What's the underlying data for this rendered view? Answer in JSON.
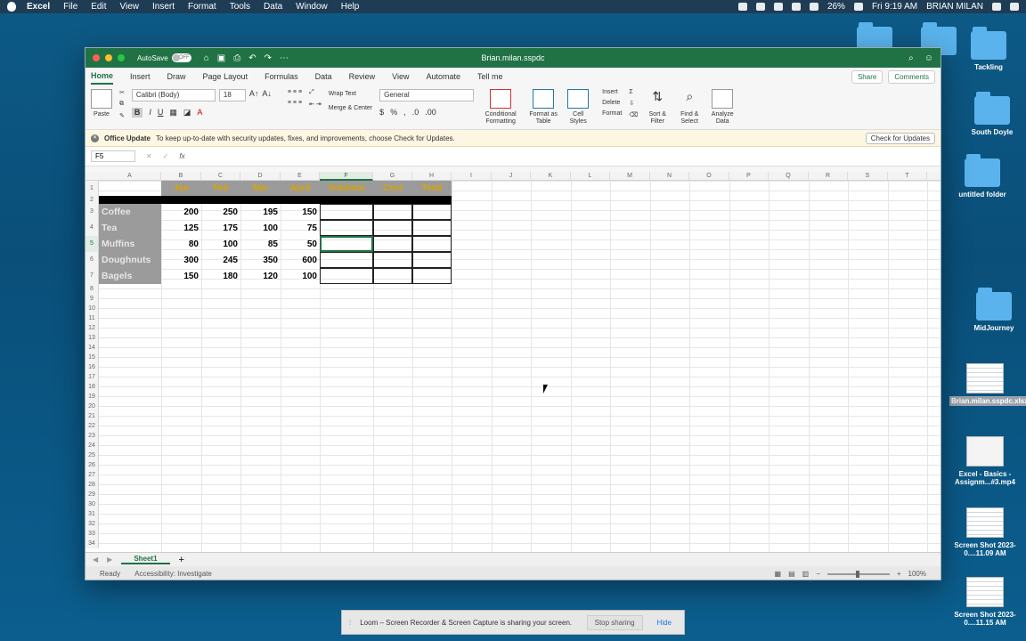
{
  "menubar": {
    "app": "Excel",
    "items": [
      "File",
      "Edit",
      "View",
      "Insert",
      "Format",
      "Tools",
      "Data",
      "Window",
      "Help"
    ],
    "battery": "26%",
    "clock": "Fri 9:19 AM",
    "user": "BRIAN MILAN"
  },
  "desktop": {
    "icons": [
      {
        "label": "Tackling",
        "type": "folder"
      },
      {
        "label": "South Doyle",
        "type": "folder"
      },
      {
        "label": "untitled folder",
        "type": "folder"
      },
      {
        "label": "MidJourney",
        "type": "folder"
      },
      {
        "label": "Brian.milan.sspdc.xlsx",
        "type": "file"
      },
      {
        "label": "Excel - Basics - Assignm...#3.mp4",
        "type": "file"
      },
      {
        "label": "Screen Shot 2023-0....11.09 AM",
        "type": "file"
      },
      {
        "label": "Screen Shot 2023-0....11.15 AM",
        "type": "file"
      }
    ]
  },
  "window": {
    "autosave_label": "AutoSave",
    "autosave_state": "OFF",
    "doc_title": "Brian.milan.sspdc",
    "tabs": [
      "Home",
      "Insert",
      "Draw",
      "Page Layout",
      "Formulas",
      "Data",
      "Review",
      "View",
      "Automate",
      "Tell me"
    ],
    "share": "Share",
    "comments": "Comments"
  },
  "ribbon": {
    "paste": "Paste",
    "font_name": "Calibri (Body)",
    "font_size": "18",
    "wrap_text": "Wrap Text",
    "merge_center": "Merge & Center",
    "number_format": "General",
    "conditional_formatting": "Conditional Formatting",
    "format_as_table": "Format as Table",
    "cell_styles": "Cell Styles",
    "insert": "Insert",
    "delete": "Delete",
    "format": "Format",
    "sort_filter": "Sort & Filter",
    "find_select": "Find & Select",
    "analyze_data": "Analyze Data"
  },
  "update_bar": {
    "title": "Office Update",
    "message": "To keep up-to-date with security updates, fixes, and improvements, choose Check for Updates.",
    "button": "Check for Updates"
  },
  "formula_bar": {
    "name_box": "F5",
    "fx": "fx",
    "value": ""
  },
  "columns": [
    "A",
    "B",
    "C",
    "D",
    "E",
    "F",
    "G",
    "H",
    "I",
    "J",
    "K",
    "L",
    "M",
    "N",
    "O",
    "P",
    "Q",
    "R",
    "S",
    "T"
  ],
  "sheet": {
    "headers": [
      "Jan",
      "Feb",
      "Mar",
      "April",
      "Subtotal",
      "Cost",
      "Total"
    ],
    "rows": [
      {
        "label": "Coffee",
        "values": [
          "200",
          "250",
          "195",
          "150"
        ]
      },
      {
        "label": "Tea",
        "values": [
          "125",
          "175",
          "100",
          "75"
        ]
      },
      {
        "label": "Muffins",
        "values": [
          "80",
          "100",
          "85",
          "50"
        ]
      },
      {
        "label": "Doughnuts",
        "values": [
          "300",
          "245",
          "350",
          "600"
        ]
      },
      {
        "label": "Bagels",
        "values": [
          "150",
          "180",
          "120",
          "100"
        ]
      }
    ]
  },
  "sheet_tabs": {
    "active": "Sheet1",
    "add": "+"
  },
  "status_bar": {
    "ready": "Ready",
    "accessibility": "Accessibility: Investigate",
    "zoom": "100%"
  },
  "loom": {
    "message": "Loom – Screen Recorder & Screen Capture is sharing your screen.",
    "stop": "Stop sharing",
    "hide": "Hide"
  }
}
